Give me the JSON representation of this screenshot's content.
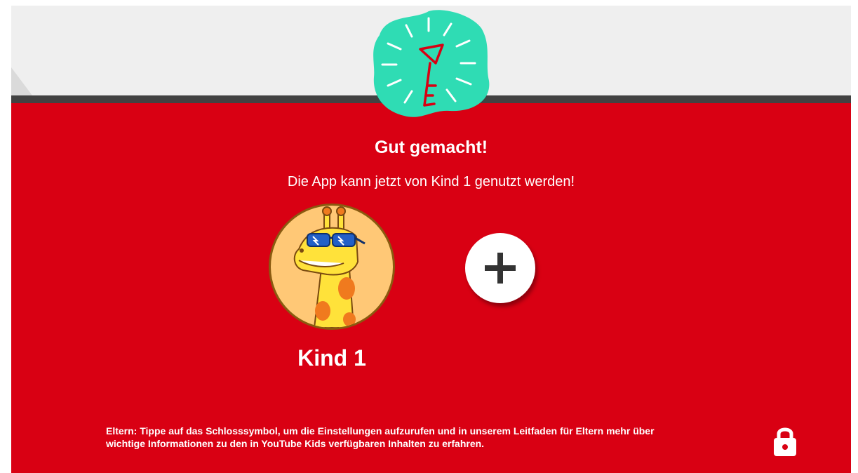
{
  "header": {
    "badge_icon": "key-icon"
  },
  "main": {
    "title": "Gut gemacht!",
    "subtitle": "Die App kann jetzt von Kind 1 genutzt werden!"
  },
  "profiles": [
    {
      "name": "Kind 1",
      "avatar_icon": "giraffe-avatar-icon"
    }
  ],
  "add_profile": {
    "icon": "plus-icon"
  },
  "footer": {
    "parent_line_1": "Eltern: Tippe auf das Schlosssymbol, um die Einstellungen aufzurufen und in unserem Leitfaden für Eltern mehr über",
    "parent_line_2": "wichtige Informationen zu den in YouTube Kids verfügbaren Inhalten zu erfahren.",
    "lock_icon": "lock-icon"
  },
  "colors": {
    "primary_red": "#d90013",
    "badge_teal": "#2fdcb4",
    "top_band": "#efefef",
    "dark_bar": "#424242",
    "avatar_bg": "#ffc876"
  }
}
